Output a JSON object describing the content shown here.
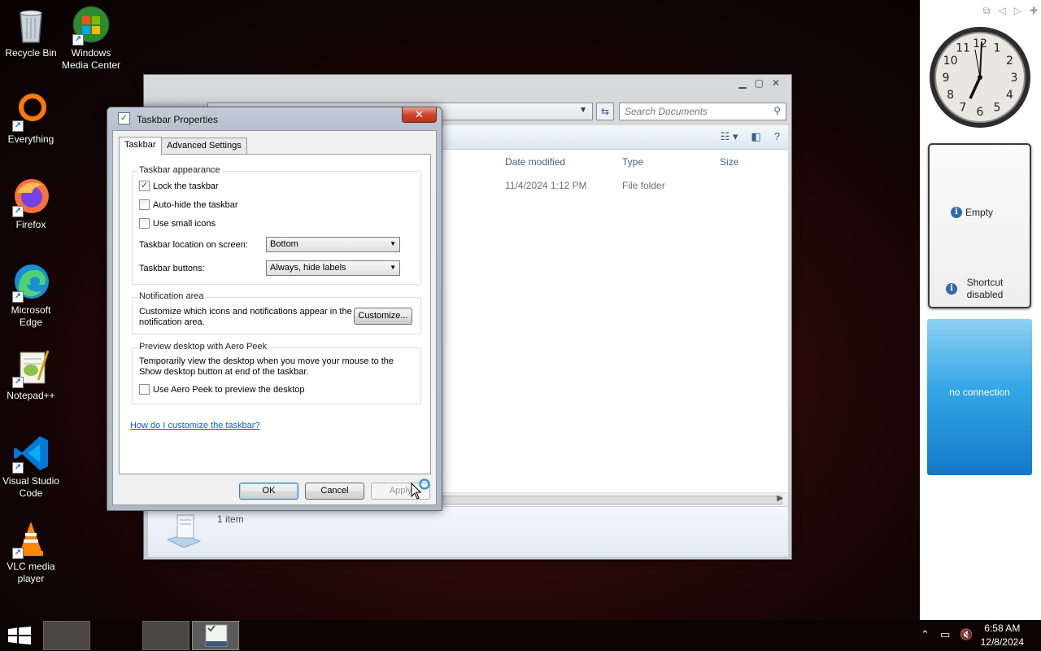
{
  "desktop": {
    "icons": [
      {
        "label": "Recycle Bin",
        "icon": "recycle-bin-icon"
      },
      {
        "label": "Windows Media Center",
        "icon": "media-center-icon"
      },
      {
        "label": "Everything",
        "icon": "everything-search-icon"
      },
      {
        "label": "Firefox",
        "icon": "firefox-icon"
      },
      {
        "label": "Microsoft Edge",
        "icon": "edge-icon"
      },
      {
        "label": "Notepad++",
        "icon": "notepadpp-icon"
      },
      {
        "label": "Visual Studio Code",
        "icon": "vscode-icon"
      },
      {
        "label": "VLC media player",
        "icon": "vlc-icon"
      }
    ]
  },
  "explorer": {
    "search_placeholder": "Search Documents",
    "columns": [
      "Date modified",
      "Type",
      "Size"
    ],
    "rows": [
      {
        "date_modified": "11/4/2024 1:12 PM",
        "type": "File folder",
        "size": ""
      }
    ],
    "item_count": "1 item"
  },
  "dialog": {
    "title": "Taskbar Properties",
    "tabs": [
      "Taskbar",
      "Advanced Settings"
    ],
    "active_tab": "Taskbar",
    "appearance": {
      "legend": "Taskbar appearance",
      "lock_taskbar": {
        "label": "Lock the taskbar",
        "checked": true
      },
      "auto_hide": {
        "label": "Auto-hide the taskbar",
        "checked": false
      },
      "small_icons": {
        "label": "Use small icons",
        "checked": false
      },
      "location_label": "Taskbar location on screen:",
      "location_value": "Bottom",
      "buttons_label": "Taskbar buttons:",
      "buttons_value": "Always, hide labels"
    },
    "notification": {
      "legend": "Notification area",
      "description": "Customize which icons and notifications appear in the notification area.",
      "customize_button": "Customize..."
    },
    "aero_peek": {
      "legend": "Preview desktop with Aero Peek",
      "description": "Temporarily view the desktop when you move your mouse to the Show desktop button at end of the taskbar.",
      "checkbox": {
        "label": "Use Aero Peek to preview the desktop",
        "checked": false
      }
    },
    "help_link": "How do I customize the taskbar?",
    "ok_button": "OK",
    "cancel_button": "Cancel",
    "apply_button": "Apply",
    "close_glyph": "✕"
  },
  "gadgets": {
    "clock": {
      "numbers": [
        "12",
        "1",
        "2",
        "3",
        "4",
        "5",
        "6",
        "7",
        "8",
        "9",
        "10",
        "11"
      ]
    },
    "slideshow": {
      "empty_text": "Empty",
      "shortcut_text": "Shortcut disabled"
    },
    "weather": {
      "text": "no connection"
    }
  },
  "taskbar": {
    "time": "6:58 AM",
    "date": "12/8/2024",
    "tray_icons": [
      "chevron-up-icon",
      "network-icon",
      "volume-muted-icon"
    ]
  }
}
